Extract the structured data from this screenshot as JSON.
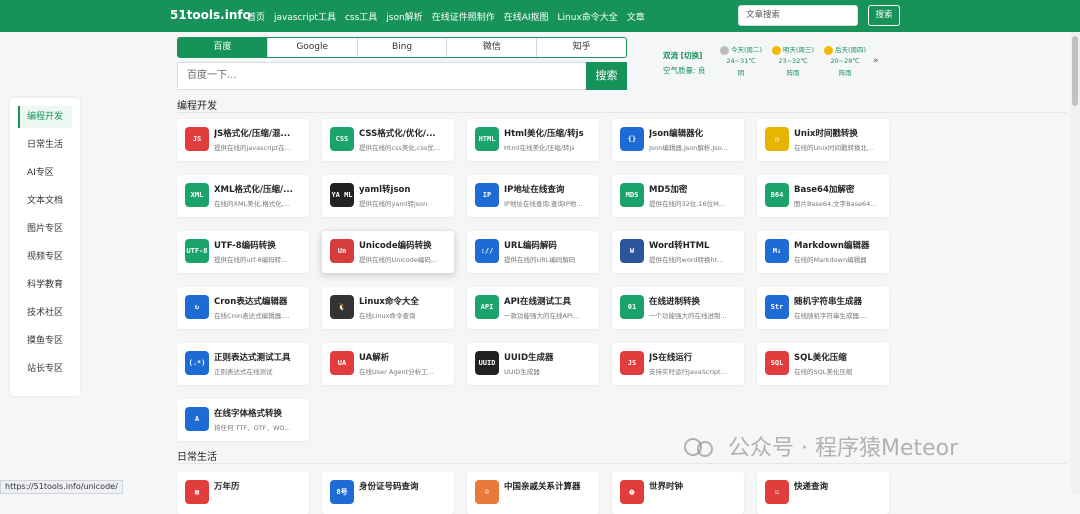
{
  "header": {
    "brand": "51tools.info",
    "nav": [
      "首页",
      "javascript工具",
      "css工具",
      "json解析",
      "在线证件照制作",
      "在线AI抠图",
      "Linux命令大全",
      "文章"
    ],
    "search_placeholder": "文章搜索",
    "search_button": "搜索"
  },
  "engines": {
    "tabs": [
      "百度",
      "Google",
      "Bing",
      "微信",
      "知乎"
    ],
    "active": "百度",
    "placeholder": "百度一下...",
    "button": "搜索"
  },
  "weather": {
    "city": "双流 [切换]",
    "air": "空气质量: 良",
    "days": [
      {
        "label": "今天(周二)",
        "temp": "24~31℃",
        "cond": "阴"
      },
      {
        "label": "明天(周三)",
        "temp": "23~32℃",
        "cond": "阵雨"
      },
      {
        "label": "后天(周四)",
        "temp": "20~28℃",
        "cond": "阵雨"
      }
    ],
    "more": "»"
  },
  "sidebar": {
    "items": [
      "编程开发",
      "日常生活",
      "AI专区",
      "文本文档",
      "图片专区",
      "视频专区",
      "科学教育",
      "技术社区",
      "摸鱼专区",
      "站长专区"
    ],
    "active": "编程开发"
  },
  "sections": {
    "dev_title": "编程开发",
    "daily_title": "日常生活"
  },
  "dev_tools": [
    {
      "title": "JS格式化/压缩/混...",
      "desc": "提供在线的javascript在...",
      "icon": "js-icon",
      "icon_text": "JS",
      "color": "#e23d3d"
    },
    {
      "title": "CSS格式化/优化/...",
      "desc": "提供在线的css美化,css优...",
      "icon": "css-icon",
      "icon_text": "CSS",
      "color": "#1aa36b"
    },
    {
      "title": "Html美化/压缩/转js",
      "desc": "Html在线美化/压缩/转js",
      "icon": "html-icon",
      "icon_text": "HTML",
      "color": "#1aa36b"
    },
    {
      "title": "Json编辑器化",
      "desc": "Json编辑器,Json解析,Jso...",
      "icon": "json-icon",
      "icon_text": "{}",
      "color": "#1e6bd6"
    },
    {
      "title": "Unix时间戳转换",
      "desc": "在线的Unix时间戳转换北...",
      "icon": "clock-icon",
      "icon_text": "◷",
      "color": "#e7b400"
    },
    {
      "title": "XML格式化/压缩/...",
      "desc": "在线的XML美化,格式化,...",
      "icon": "xml-icon",
      "icon_text": "XML",
      "color": "#1aa36b"
    },
    {
      "title": "yaml转json",
      "desc": "提供在线的yaml转json",
      "icon": "yaml-icon",
      "icon_text": "YA ML",
      "color": "#222222"
    },
    {
      "title": "IP地址在线查询",
      "desc": "IP地址在线查询,查询IP地...",
      "icon": "ip-icon",
      "icon_text": "IP",
      "color": "#1e6bd6"
    },
    {
      "title": "MD5加密",
      "desc": "提供在线的32位,16位M...",
      "icon": "md5-icon",
      "icon_text": "MD5",
      "color": "#1aa36b"
    },
    {
      "title": "Base64加解密",
      "desc": "图片Base64,文字Base64...",
      "icon": "base64-icon",
      "icon_text": "B64",
      "color": "#1aa36b"
    },
    {
      "title": "UTF-8编码转换",
      "desc": "提供在线的utf-8编码转...",
      "icon": "utf8-icon",
      "icon_text": "UTF-8",
      "color": "#1aa36b"
    },
    {
      "title": "Unicode编码转换",
      "desc": "提供在线的Unicode编码...",
      "icon": "unicode-icon",
      "icon_text": "Un",
      "color": "#d63c3c"
    },
    {
      "title": "URL编码解码",
      "desc": "提供在线的URL编码解码",
      "icon": "url-icon",
      "icon_text": "://",
      "color": "#1e6bd6"
    },
    {
      "title": "Word转HTML",
      "desc": "提供在线的word转换ht...",
      "icon": "word-icon",
      "icon_text": "W",
      "color": "#2b579a"
    },
    {
      "title": "Markdown编辑器",
      "desc": "在线的Markdown编辑器",
      "icon": "markdown-icon",
      "icon_text": "M↓",
      "color": "#1e6bd6"
    },
    {
      "title": "Cron表达式编辑器",
      "desc": "在线Cron表达式编辑器,...",
      "icon": "cron-icon",
      "icon_text": "↻",
      "color": "#1e6bd6"
    },
    {
      "title": "Linux命令大全",
      "desc": "在线Linux命令查询",
      "icon": "linux-icon",
      "icon_text": "🐧",
      "color": "#333333"
    },
    {
      "title": "API在线测试工具",
      "desc": "一款功能强大的在线API...",
      "icon": "api-icon",
      "icon_text": "API",
      "color": "#1aa36b"
    },
    {
      "title": "在线进制转换",
      "desc": "一个功能强大的在线进制...",
      "icon": "binary-icon",
      "icon_text": "01",
      "color": "#1aa36b"
    },
    {
      "title": "随机字符串生成器",
      "desc": "在线随机字符串生成器,...",
      "icon": "string-icon",
      "icon_text": "Str",
      "color": "#1e6bd6"
    },
    {
      "title": "正则表达式测试工具",
      "desc": "正则表达式在线测试",
      "icon": "regex-icon",
      "icon_text": "(.*)",
      "color": "#1e6bd6"
    },
    {
      "title": "UA解析",
      "desc": "在线User Agent分析工...",
      "icon": "ua-icon",
      "icon_text": "UA",
      "color": "#e23d3d"
    },
    {
      "title": "UUID生成器",
      "desc": "UUID生成器",
      "icon": "uuid-icon",
      "icon_text": "UUID",
      "color": "#222222"
    },
    {
      "title": "JS在线运行",
      "desc": "支持实时运行JavaScript...",
      "icon": "js-run-icon",
      "icon_text": "JS",
      "color": "#e23d3d"
    },
    {
      "title": "SQL美化压缩",
      "desc": "在线的SQL美化压缩",
      "icon": "sql-icon",
      "icon_text": "SQL",
      "color": "#e23d3d"
    },
    {
      "title": "在线字体格式转换",
      "desc": "将任何 TTF、OTF、WO...",
      "icon": "font-icon",
      "icon_text": "A",
      "color": "#1e6bd6"
    }
  ],
  "daily_tools": [
    {
      "title": "万年历",
      "icon": "calendar-icon",
      "icon_text": "▦",
      "color": "#e23d3d"
    },
    {
      "title": "身份证号码查询",
      "icon": "id-card-icon",
      "icon_text": "8号",
      "color": "#1e6bd6"
    },
    {
      "title": "中国亲戚关系计算器",
      "icon": "family-icon",
      "icon_text": "☺",
      "color": "#e87a3d"
    },
    {
      "title": "世界时钟",
      "icon": "alarm-icon",
      "icon_text": "⏰",
      "color": "#e23d3d"
    },
    {
      "title": "快递查询",
      "icon": "package-icon",
      "icon_text": "☑",
      "color": "#e23d3d"
    }
  ],
  "watermark": "公众号 · 程序猿Meteor",
  "status_url": "https://51tools.info/unicode/"
}
